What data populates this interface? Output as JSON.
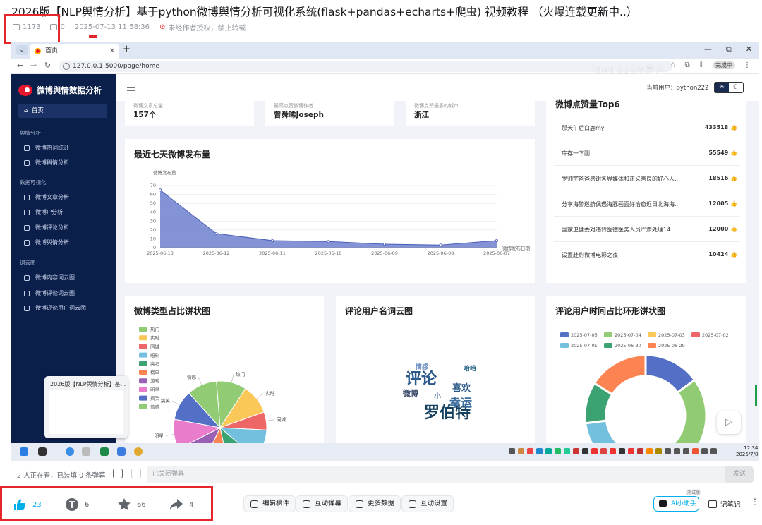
{
  "page": {
    "title": "2026版【NLP舆情分析】基于python微博舆情分析可视化系统(flask+pandas+echarts+爬虫) 视频教程 （火爆连载更新中..）",
    "plays": "1173",
    "danmaku_count": "0",
    "date": "2025-07-13 11:58:36",
    "copyright": "未经作者授权，禁止转载"
  },
  "browser": {
    "tab_title": "首页",
    "url": "127.0.0.1:5000/page/home",
    "profile": "完成中",
    "watermark": "java1234宫方"
  },
  "sidebar": {
    "app_name": "微博舆情数据分析",
    "home": "首页",
    "groups": [
      {
        "title": "舆情分析",
        "items": [
          "微博热词统计",
          "微博舆情分析"
        ]
      },
      {
        "title": "数据可视化",
        "items": [
          "微博文章分析",
          "微博IP分析",
          "微博评论分析",
          "微博舆情分析"
        ]
      },
      {
        "title": "词云图",
        "items": [
          "微博内容词云图",
          "微博评论词云图",
          "微博评论用户词云图"
        ]
      }
    ]
  },
  "header": {
    "current_user": "当前用户：python222",
    "light_icon": "☀",
    "dark_icon": "☾"
  },
  "stats": [
    {
      "label": "微博文章总量",
      "value": "157个"
    },
    {
      "label": "最高点赞微博作者",
      "value": "曾舜晞Joseph"
    },
    {
      "label": "微博点赞最多的城市",
      "value": "浙江"
    }
  ],
  "top6": {
    "title": "微博点赞量Top6",
    "rows": [
      {
        "name": "那天午后白鹿my",
        "value": "433518"
      },
      {
        "name": "库存一下刚",
        "value": "55549"
      },
      {
        "name": "罗帅宇爸爸感谢各界媒体和正义善良的好心人...",
        "value": "18516"
      },
      {
        "name": "分享海警巡航偶遇海豚画面好治愈近日北海海...",
        "value": "12005"
      },
      {
        "name": "国家卫健委对违背医德医务人员严肃处理14...",
        "value": "12000"
      },
      {
        "name": "设置赴约微博电影之夜",
        "value": "10424"
      }
    ]
  },
  "cards": {
    "line_title": "最近七天微博发布量",
    "pie_title": "微博类型占比饼状图",
    "cloud_title": "评论用户名词云图",
    "donut_title": "评论用户时间占比环形饼状图"
  },
  "chart_data": [
    {
      "type": "area",
      "title": "最近七天微博发布量",
      "ylabel": "微博发布量",
      "xlabel": "微博发布日期",
      "categories": [
        "2025-06-13",
        "2025-06-12",
        "2025-06-11",
        "2025-06-10",
        "2025-06-09",
        "2025-06-08",
        "2025-06-07"
      ],
      "values": [
        65,
        16,
        8,
        7,
        4,
        3,
        8
      ],
      "ylim": [
        0,
        70
      ],
      "yticks": [
        0,
        10,
        20,
        30,
        40,
        50,
        60,
        70
      ],
      "color": "#5b6fc7"
    },
    {
      "type": "pie",
      "title": "微博类型占比饼状图",
      "legend_position": "left",
      "categories": [
        "热门",
        "实时",
        "同城",
        "短剧",
        "高考",
        "榜单",
        "游戏",
        "明星",
        "搞笑",
        "情感"
      ],
      "values": [
        10,
        10,
        6,
        10,
        10,
        10,
        10,
        10,
        10,
        10
      ],
      "colors": [
        "#91cc75",
        "#fac858",
        "#ee6666",
        "#73c0de",
        "#3ba272",
        "#fc8452",
        "#9a60b4",
        "#ea7ccc",
        "#5470c6",
        "#91cc75"
      ]
    },
    {
      "type": "pie",
      "title": "评论用户时间占比环形饼状图",
      "legend_position": "top",
      "categories": [
        "2025-07-05",
        "2025-07-04",
        "2025-07-03",
        "2025-07-02",
        "2025-07-01",
        "2025-06-30",
        "2025-06-29"
      ],
      "values": [
        15,
        34,
        8,
        4,
        12,
        11,
        16
      ],
      "colors": [
        "#5470c6",
        "#91cc75",
        "#fac858",
        "#ee6666",
        "#73c0de",
        "#3ba272",
        "#fc8452"
      ]
    }
  ],
  "wordcloud": [
    {
      "t": "评论",
      "s": 22,
      "c": "#2b5a8a"
    },
    {
      "t": "罗伯特",
      "s": 22,
      "c": "#16405f"
    },
    {
      "t": "喜欢",
      "s": 13,
      "c": "#2b5a8a"
    },
    {
      "t": "幸运",
      "s": 16,
      "c": "#3d6e9e"
    },
    {
      "t": "微博",
      "s": 11,
      "c": "#3a4a6a"
    },
    {
      "t": "小",
      "s": 10,
      "c": "#5a7ab0"
    },
    {
      "t": "情感",
      "s": 9,
      "c": "#6a8ac0"
    },
    {
      "t": "哈哈",
      "s": 9,
      "c": "#2f6a8a"
    }
  ],
  "taskbar": {
    "time": "12:34",
    "date": "2025/7/8",
    "thumb_title": "2026版【NLP舆情分析】基..."
  },
  "danmaku": {
    "watching": "2 人正在看，已装填 0 条弹幕",
    "placeholder": "已关闭弹幕",
    "send": "发送"
  },
  "actions": {
    "like": "23",
    "coin": "6",
    "fav": "66",
    "share": "4",
    "edit": "编辑稿件",
    "interact": "互动弹幕",
    "data": "更多数据",
    "settings": "互动设置",
    "ai": "AI小助手",
    "beta": "测试版",
    "note": "记笔记"
  }
}
